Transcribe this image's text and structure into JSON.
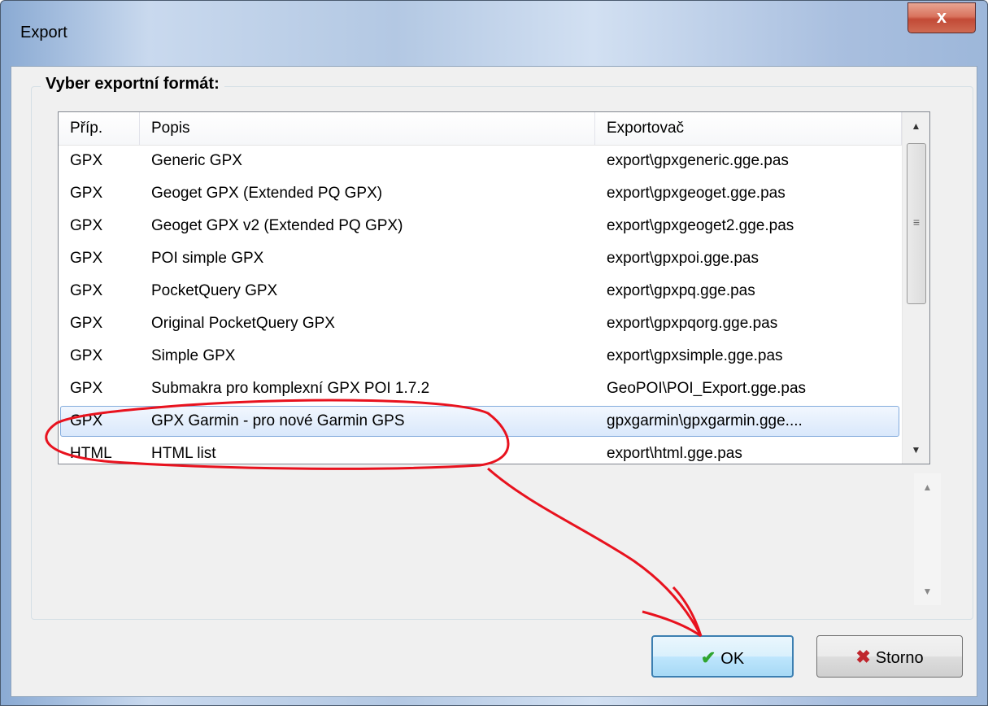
{
  "window": {
    "title": "Export",
    "close_glyph": "x"
  },
  "group": {
    "label": "Vyber exportní formát:"
  },
  "table": {
    "columns": [
      "Příp.",
      "Popis",
      "Exportovač"
    ],
    "rows": [
      [
        "GPX",
        "Generic GPX",
        "export\\gpxgeneric.gge.pas"
      ],
      [
        "GPX",
        "Geoget GPX (Extended PQ GPX)",
        "export\\gpxgeoget.gge.pas"
      ],
      [
        "GPX",
        "Geoget GPX v2 (Extended PQ GPX)",
        "export\\gpxgeoget2.gge.pas"
      ],
      [
        "GPX",
        "POI simple GPX",
        "export\\gpxpoi.gge.pas"
      ],
      [
        "GPX",
        "PocketQuery GPX",
        "export\\gpxpq.gge.pas"
      ],
      [
        "GPX",
        "Original PocketQuery GPX",
        "export\\gpxpqorg.gge.pas"
      ],
      [
        "GPX",
        "Simple GPX",
        "export\\gpxsimple.gge.pas"
      ],
      [
        "GPX",
        "Submakra pro komplexní GPX POI 1.7.2",
        "GeoPOI\\POI_Export.gge.pas"
      ],
      [
        "GPX",
        "GPX Garmin - pro nové Garmin GPS",
        "gpxgarmin\\gpxgarmin.gge...."
      ],
      [
        "HTML",
        "HTML list",
        "export\\html.gge.pas"
      ]
    ],
    "selected_row": 8
  },
  "buttons": {
    "ok": "OK",
    "cancel": "Storno"
  },
  "icons": {
    "ok": "check-icon",
    "cancel": "x-icon",
    "close": "close-icon"
  },
  "colors": {
    "annotation": "#e8121e",
    "selection_border": "#84acdd",
    "ok_border": "#3c7fb1"
  }
}
